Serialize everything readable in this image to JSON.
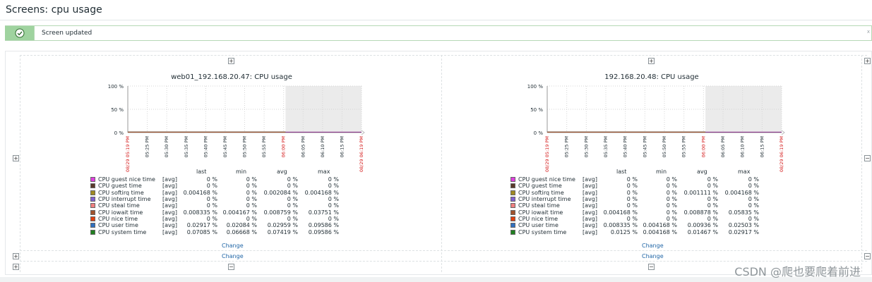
{
  "page": {
    "title": "Screens: cpu usage",
    "message": "Screen updated",
    "message_close": "x",
    "watermark": "CSDN @爬也要爬着前进"
  },
  "colors": {
    "accent_green": "#9fd39f",
    "link_blue": "#1f65a6",
    "axis_red": "#d62020",
    "future_area": "#ebebeb"
  },
  "controls": {
    "add": "+",
    "remove": "−",
    "change": "Change"
  },
  "legend_header": {
    "last": "last",
    "min": "min",
    "avg": "avg",
    "max": "max"
  },
  "graphs": [
    {
      "title": "web01_192.168.20.47: CPU usage",
      "legend": [
        {
          "name": "CPU guest nice time",
          "func": "[avg]",
          "last": "0 %",
          "min": "0 %",
          "avg": "0 %",
          "max": "0 %",
          "color": "#e040e0"
        },
        {
          "name": "CPU guest time",
          "func": "[avg]",
          "last": "0 %",
          "min": "0 %",
          "avg": "0 %",
          "max": "0 %",
          "color": "#5a3a2a"
        },
        {
          "name": "CPU softirq time",
          "func": "[avg]",
          "last": "0.004168 %",
          "min": "0 %",
          "avg": "0.002084 %",
          "max": "0.004168 %",
          "color": "#a08a20"
        },
        {
          "name": "CPU interrupt time",
          "func": "[avg]",
          "last": "0 %",
          "min": "0 %",
          "avg": "0 %",
          "max": "0 %",
          "color": "#8060d0"
        },
        {
          "name": "CPU steal time",
          "func": "[avg]",
          "last": "0 %",
          "min": "0 %",
          "avg": "0 %",
          "max": "0 %",
          "color": "#f08080"
        },
        {
          "name": "CPU iowait time",
          "func": "[avg]",
          "last": "0.008335 %",
          "min": "0.004167 %",
          "avg": "0.008759 %",
          "max": "0.03751 %",
          "color": "#a0522d"
        },
        {
          "name": "CPU nice time",
          "func": "[avg]",
          "last": "0 %",
          "min": "0 %",
          "avg": "0 %",
          "max": "0 %",
          "color": "#e04010"
        },
        {
          "name": "CPU user time",
          "func": "[avg]",
          "last": "0.02917 %",
          "min": "0.02084 %",
          "avg": "0.02959 %",
          "max": "0.09586 %",
          "color": "#3070c0"
        },
        {
          "name": "CPU system time",
          "func": "[avg]",
          "last": "0.07085 %",
          "min": "0.06668 %",
          "avg": "0.07419 %",
          "max": "0.09586 %",
          "color": "#208020"
        }
      ]
    },
    {
      "title": "192.168.20.48: CPU usage",
      "legend": [
        {
          "name": "CPU guest nice time",
          "func": "[avg]",
          "last": "0 %",
          "min": "0 %",
          "avg": "0 %",
          "max": "0 %",
          "color": "#e040e0"
        },
        {
          "name": "CPU guest time",
          "func": "[avg]",
          "last": "0 %",
          "min": "0 %",
          "avg": "0 %",
          "max": "0 %",
          "color": "#5a3a2a"
        },
        {
          "name": "CPU softirq time",
          "func": "[avg]",
          "last": "0 %",
          "min": "0 %",
          "avg": "0.001111 %",
          "max": "0.004168 %",
          "color": "#a08a20"
        },
        {
          "name": "CPU interrupt time",
          "func": "[avg]",
          "last": "0 %",
          "min": "0 %",
          "avg": "0 %",
          "max": "0 %",
          "color": "#8060d0"
        },
        {
          "name": "CPU steal time",
          "func": "[avg]",
          "last": "0 %",
          "min": "0 %",
          "avg": "0 %",
          "max": "0 %",
          "color": "#f08080"
        },
        {
          "name": "CPU iowait time",
          "func": "[avg]",
          "last": "0.004168 %",
          "min": "0 %",
          "avg": "0.008878 %",
          "max": "0.05835 %",
          "color": "#a0522d"
        },
        {
          "name": "CPU nice time",
          "func": "[avg]",
          "last": "0 %",
          "min": "0 %",
          "avg": "0 %",
          "max": "0 %",
          "color": "#e04010"
        },
        {
          "name": "CPU user time",
          "func": "[avg]",
          "last": "0.008335 %",
          "min": "0.004168 %",
          "avg": "0.00936 %",
          "max": "0.02503 %",
          "color": "#3070c0"
        },
        {
          "name": "CPU system time",
          "func": "[avg]",
          "last": "0.0125 %",
          "min": "0.004168 %",
          "avg": "0.01467 %",
          "max": "0.02917 %",
          "color": "#208020"
        }
      ]
    }
  ],
  "chart_data": [
    {
      "type": "line",
      "title": "web01_192.168.20.47: CPU usage",
      "ylim": [
        0,
        100
      ],
      "y_ticks": [
        "0 %",
        "50 %",
        "100 %"
      ],
      "x_ticks": [
        "08/29 05:19 PM",
        "05:25 PM",
        "05:30 PM",
        "05:35 PM",
        "05:40 PM",
        "05:45 PM",
        "05:50 PM",
        "05:55 PM",
        "06:00 PM",
        "06:05 PM",
        "06:10 PM",
        "06:15 PM",
        "08/29 06:19 PM"
      ],
      "x_ticks_red": [
        "08/29 05:19 PM",
        "06:00 PM",
        "08/29 06:19 PM"
      ],
      "grid": true,
      "series": [
        {
          "name": "CPU system time",
          "values": [
            0.07,
            0.07,
            0.07,
            0.07,
            0.07,
            0.07,
            0.07,
            0.07,
            0.07
          ]
        },
        {
          "name": "CPU user time",
          "values": [
            0.03,
            0.03,
            0.03,
            0.03,
            0.03,
            0.03,
            0.03,
            0.03,
            0.03
          ]
        },
        {
          "name": "CPU iowait time",
          "values": [
            0.01,
            0.01,
            0.01,
            0.01,
            0.01,
            0.01,
            0.01,
            0.01,
            0.01
          ]
        }
      ]
    },
    {
      "type": "line",
      "title": "192.168.20.48: CPU usage",
      "ylim": [
        0,
        100
      ],
      "y_ticks": [
        "0 %",
        "50 %",
        "100 %"
      ],
      "x_ticks": [
        "08/29 05:19 PM",
        "05:25 PM",
        "05:30 PM",
        "05:35 PM",
        "05:40 PM",
        "05:45 PM",
        "05:50 PM",
        "05:55 PM",
        "06:00 PM",
        "06:05 PM",
        "06:10 PM",
        "06:15 PM",
        "08/29 06:19 PM"
      ],
      "x_ticks_red": [
        "08/29 05:19 PM",
        "06:00 PM",
        "08/29 06:19 PM"
      ],
      "grid": true,
      "series": [
        {
          "name": "CPU system time",
          "values": [
            0.01,
            0.01,
            0.01,
            0.01,
            0.01,
            0.01,
            0.01,
            0.01,
            0.01
          ]
        },
        {
          "name": "CPU user time",
          "values": [
            0.01,
            0.01,
            0.01,
            0.01,
            0.01,
            0.01,
            0.01,
            0.01,
            0.01
          ]
        },
        {
          "name": "CPU iowait time",
          "values": [
            0.01,
            0.01,
            0.01,
            0.01,
            0.01,
            0.01,
            0.01,
            0.01,
            0.01
          ]
        }
      ]
    }
  ]
}
